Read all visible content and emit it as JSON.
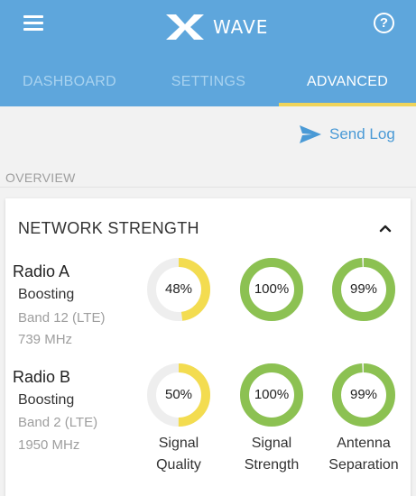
{
  "app": {
    "brand": "WAVE",
    "help_symbol": "?"
  },
  "tabs": [
    {
      "label": "DASHBOARD",
      "active": false
    },
    {
      "label": "SETTINGS",
      "active": false
    },
    {
      "label": "ADVANCED",
      "active": true
    }
  ],
  "actions": {
    "send_log_label": "Send Log"
  },
  "section": {
    "label": "OVERVIEW"
  },
  "network_card": {
    "title": "NETWORK STRENGTH",
    "columns": [
      {
        "line1": "Signal",
        "line2": "Quality"
      },
      {
        "line1": "Signal",
        "line2": "Strength"
      },
      {
        "line1": "Antenna",
        "line2": "Separation"
      }
    ],
    "radios": [
      {
        "name": "Radio A",
        "status": "Boosting",
        "band": "Band 12 (LTE)",
        "frequency": "739 MHz",
        "gauges": [
          {
            "value": 48,
            "label": "48%",
            "color": "#f3dc50"
          },
          {
            "value": 100,
            "label": "100%",
            "color": "#8cc152"
          },
          {
            "value": 99,
            "label": "99%",
            "color": "#8cc152"
          }
        ]
      },
      {
        "name": "Radio B",
        "status": "Boosting",
        "band": "Band 2 (LTE)",
        "frequency": "1950 MHz",
        "gauges": [
          {
            "value": 50,
            "label": "50%",
            "color": "#f3dc50"
          },
          {
            "value": 100,
            "label": "100%",
            "color": "#8cc152"
          },
          {
            "value": 99,
            "label": "99%",
            "color": "#8cc152"
          }
        ]
      }
    ]
  },
  "colors": {
    "header_bg": "#5ea6dc",
    "tab_indicator": "#f0d45a",
    "link": "#4a9ad6",
    "gauge_track": "#eeeeee"
  },
  "icons": {
    "menu": "hamburger-menu-icon",
    "logo": "x-logo-icon",
    "help": "help-circle-icon",
    "send": "send-paper-plane-icon",
    "collapse": "chevron-up-icon"
  }
}
